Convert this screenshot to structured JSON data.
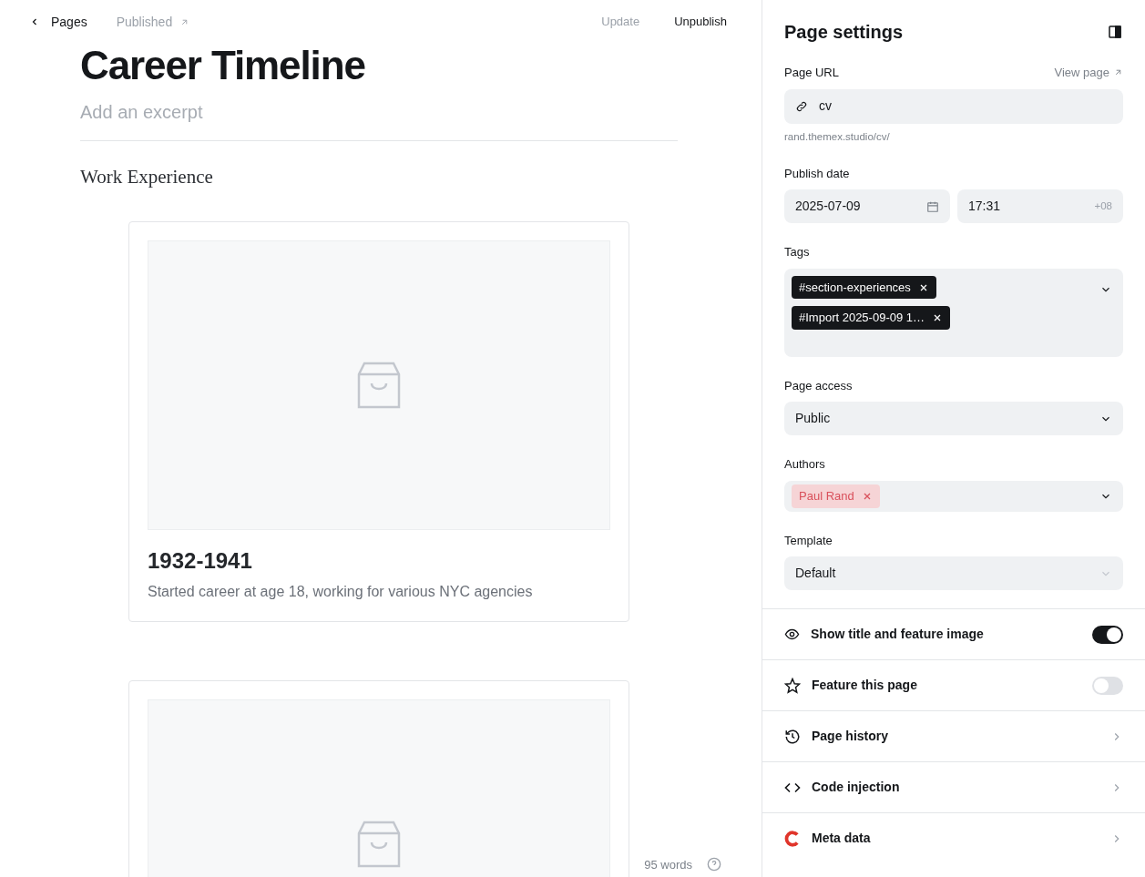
{
  "header": {
    "back_label": "Pages",
    "status": "Published",
    "actions": [
      {
        "label": "Update",
        "disabled": true
      },
      {
        "label": "Unpublish",
        "disabled": false
      }
    ]
  },
  "editor": {
    "title": "Career Timeline",
    "excerpt": {
      "placeholder": "Add an excerpt"
    },
    "heading": "Work Experience",
    "cards": [
      {
        "kind": "captioned",
        "title": "1932-1941",
        "text": "Started career at age 18, working for various NYC agencies"
      },
      {
        "kind": "image-only"
      }
    ],
    "word_count": "95 words"
  },
  "settings": {
    "title": "Page settings",
    "url": {
      "label": "Page URL",
      "link": "View page",
      "value": "cv",
      "hint": "rand.themex.studio/cv/"
    },
    "publish_date": {
      "label": "Publish date",
      "date": "2025-07-09",
      "time": "17:31",
      "timezone": "+08"
    },
    "tags": {
      "label": "Tags",
      "items": [
        "#section-experiences",
        "#Import 2025-09-09 1…"
      ]
    },
    "access": {
      "label": "Page access",
      "value": "Public"
    },
    "authors": {
      "label": "Authors",
      "items": [
        "Paul Rand"
      ]
    },
    "template": {
      "label": "Template",
      "value": "Default",
      "disabled": true
    },
    "rows": [
      {
        "kind": "toggle",
        "label": "Show title and feature image",
        "on": true
      },
      {
        "kind": "toggle",
        "label": "Feature this page",
        "on": false
      },
      {
        "kind": "link",
        "label": "Page history"
      },
      {
        "kind": "link",
        "label": "Code injection"
      },
      {
        "kind": "link",
        "label": "Meta data"
      }
    ]
  }
}
